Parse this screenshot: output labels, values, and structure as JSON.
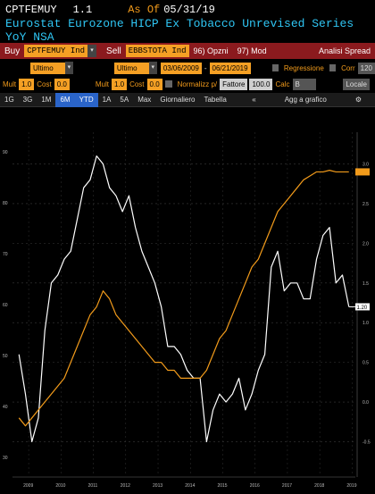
{
  "header": {
    "ticker": "CPTFEMUY",
    "version": "1.1",
    "as_of_label": "As Of",
    "as_of_date": "05/31/19",
    "title": "Eurostat Eurozone HICP Ex Tobacco Unrevised Series YoY NSA"
  },
  "toolbar": {
    "buy_label": "Buy",
    "buy_value": "CPTFEMUY Ind",
    "sell_label": "Sell",
    "sell_value": "EBBSTOTA Ind",
    "options_label": "96) Opzni",
    "mod_label": "97) Mod",
    "analysis_label": "Analisi Spread"
  },
  "row2": {
    "buy_field": "Ultimo prz",
    "sell_field": "Ultimo prz",
    "start_date": "03/06/2009",
    "end_date": "06/21/2019",
    "regression_label": "Regressione",
    "corr_label": "Corr",
    "corr_value": "120"
  },
  "row3": {
    "mult_label": "Mult",
    "mult_value": "1.0",
    "cost_label": "Cost",
    "cost_value": "0.0",
    "mult2_label": "Mult",
    "mult2_value": "1.0",
    "cost2_label": "Cost",
    "cost2_value": "0.0",
    "normalize_label": "Normalizz p/",
    "factor_label": "Fattore",
    "factor_value": "100.0",
    "calc_label": "Calc",
    "calc_value": "B",
    "currency_label": "Locale"
  },
  "tabs": {
    "items": [
      "1G",
      "3G",
      "1M",
      "6M",
      "YTD",
      "1A",
      "5A",
      "Max",
      "Giornaliero",
      "Tabella"
    ],
    "selected": "YTD",
    "back_label": "«",
    "add_label": "Agg a grafico",
    "settings_label": "⚙"
  },
  "chart_data": {
    "type": "line",
    "x": [
      2009.2,
      2009.4,
      2009.6,
      2009.8,
      2010.0,
      2010.2,
      2010.4,
      2010.6,
      2010.8,
      2011.0,
      2011.2,
      2011.4,
      2011.6,
      2011.8,
      2012.0,
      2012.2,
      2012.4,
      2012.6,
      2012.8,
      2013.0,
      2013.2,
      2013.4,
      2013.6,
      2013.8,
      2014.0,
      2014.2,
      2014.4,
      2014.6,
      2014.8,
      2015.0,
      2015.2,
      2015.4,
      2015.6,
      2015.8,
      2016.0,
      2016.2,
      2016.4,
      2016.6,
      2016.8,
      2017.0,
      2017.2,
      2017.4,
      2017.6,
      2017.8,
      2018.0,
      2018.2,
      2018.4,
      2018.6,
      2018.8,
      2019.0,
      2019.2,
      2019.4
    ],
    "series": [
      {
        "color": "#ffffff",
        "values": [
          0.6,
          0.1,
          -0.5,
          -0.2,
          0.9,
          1.5,
          1.6,
          1.8,
          1.9,
          2.3,
          2.7,
          2.8,
          3.1,
          3.0,
          2.7,
          2.6,
          2.4,
          2.6,
          2.2,
          1.9,
          1.7,
          1.5,
          1.2,
          0.7,
          0.7,
          0.6,
          0.4,
          0.3,
          0.3,
          -0.5,
          -0.1,
          0.1,
          0.0,
          0.1,
          0.3,
          -0.1,
          0.1,
          0.4,
          0.6,
          1.7,
          1.9,
          1.4,
          1.5,
          1.5,
          1.3,
          1.3,
          1.8,
          2.1,
          2.2,
          1.5,
          1.6,
          1.2
        ]
      },
      {
        "color": "#f29b1b",
        "values": [
          -0.2,
          -0.3,
          -0.2,
          -0.1,
          0.0,
          0.1,
          0.2,
          0.3,
          0.5,
          0.7,
          0.9,
          1.1,
          1.2,
          1.4,
          1.3,
          1.1,
          1.0,
          0.9,
          0.8,
          0.7,
          0.6,
          0.5,
          0.5,
          0.4,
          0.4,
          0.3,
          0.3,
          0.3,
          0.3,
          0.4,
          0.6,
          0.8,
          0.9,
          1.1,
          1.3,
          1.5,
          1.7,
          1.8,
          2.0,
          2.2,
          2.4,
          2.5,
          2.6,
          2.7,
          2.8,
          2.85,
          2.9,
          2.9,
          2.92,
          2.9,
          2.9,
          2.9
        ]
      }
    ],
    "y_right_ticks": [
      "-0.5",
      "0.0",
      "0.5",
      "1.0",
      "1.5",
      "2.0",
      "2.5",
      "3.0"
    ],
    "y_left_ticks": [
      "30",
      "40",
      "50",
      "60",
      "70",
      "80",
      "90"
    ],
    "x_ticks": [
      "2009",
      "2010",
      "2011",
      "2012",
      "2013",
      "2014",
      "2015",
      "2016",
      "2017",
      "2018",
      "2019"
    ],
    "last_value_label": "1.20",
    "xlim": [
      2009.0,
      2019.6
    ],
    "ylim": [
      -0.9,
      3.4
    ],
    "grid": true
  }
}
